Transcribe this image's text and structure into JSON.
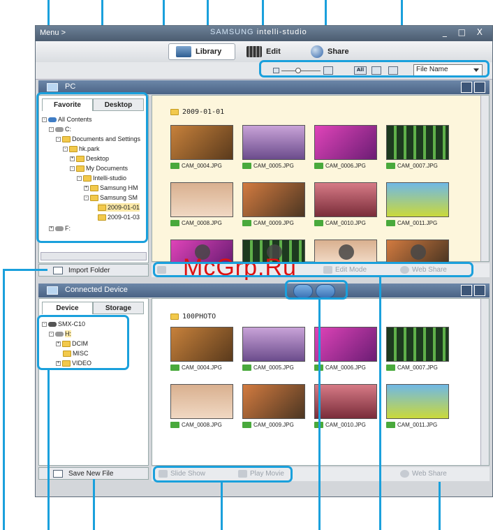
{
  "app": {
    "menu_label": "Menu >",
    "brand": "SAMSUNG",
    "product": "intelli-studio",
    "window_controls": "_ □ X"
  },
  "tabs": [
    {
      "label": "Library",
      "icon": "library-icon",
      "active": true
    },
    {
      "label": "Edit",
      "icon": "film-icon",
      "active": false
    },
    {
      "label": "Share",
      "icon": "globe-icon",
      "active": false
    }
  ],
  "toolbar": {
    "view_all": "All",
    "sort_value": "File Name"
  },
  "pc_panel": {
    "title": "PC",
    "subtabs": [
      "Favorite",
      "Desktop"
    ],
    "tree": [
      {
        "label": "All Contents",
        "icon": "pc-icon"
      },
      {
        "label": "C:",
        "icon": "drive-icon"
      },
      {
        "label": "Documents and Settings",
        "icon": "folder-icon"
      },
      {
        "label": "hk.park",
        "icon": "folder-icon"
      },
      {
        "label": "Desktop",
        "icon": "folder-icon"
      },
      {
        "label": "My Documents",
        "icon": "folder-icon"
      },
      {
        "label": "Intelli-studio",
        "icon": "folder-icon"
      },
      {
        "label": "Samsung HM",
        "icon": "folder-icon"
      },
      {
        "label": "Samsung SM",
        "icon": "folder-icon"
      },
      {
        "label": "2009-01-01",
        "icon": "folder-icon"
      },
      {
        "label": "2009-01-03",
        "icon": "folder-icon"
      },
      {
        "label": "F:",
        "icon": "drive-icon"
      }
    ],
    "button": "Import Folder",
    "folder": "2009-01-01",
    "files": [
      "CAM_0004.JPG",
      "CAM_0005.JPG",
      "CAM_0006.JPG",
      "CAM_0007.JPG",
      "CAM_0008.JPG",
      "CAM_0009.JPG",
      "CAM_0010.JPG",
      "CAM_0011.JPG"
    ],
    "bottom": {
      "edit_mode": "Edit Mode",
      "web_share": "Web Share"
    }
  },
  "device_panel": {
    "title": "Connected Device",
    "subtabs": [
      "Device",
      "Storage"
    ],
    "tree": [
      {
        "label": "SMX-C10",
        "icon": "camcorder-icon"
      },
      {
        "label": "H:",
        "icon": "drive-icon"
      },
      {
        "label": "DCIM",
        "icon": "folder-icon"
      },
      {
        "label": "MISC",
        "icon": "folder-icon"
      },
      {
        "label": "VIDEO",
        "icon": "folder-icon"
      }
    ],
    "button": "Save New File",
    "folder": "100PHOTO",
    "files": [
      "CAM_0004.JPG",
      "CAM_0005.JPG",
      "CAM_0006.JPG",
      "CAM_0007.JPG",
      "CAM_0008.JPG",
      "CAM_0009.JPG",
      "CAM_0010.JPG",
      "CAM_0011.JPG"
    ],
    "bottom": {
      "slide_show": "Slide Show",
      "play_movie": "Play Movie",
      "web_share": "Web Share"
    }
  },
  "watermark": "McGrp.Ru",
  "colors": {
    "callout": "#1aa0dc",
    "panel_header": "#4a6385",
    "folder_bg": "#fdf6dc"
  }
}
